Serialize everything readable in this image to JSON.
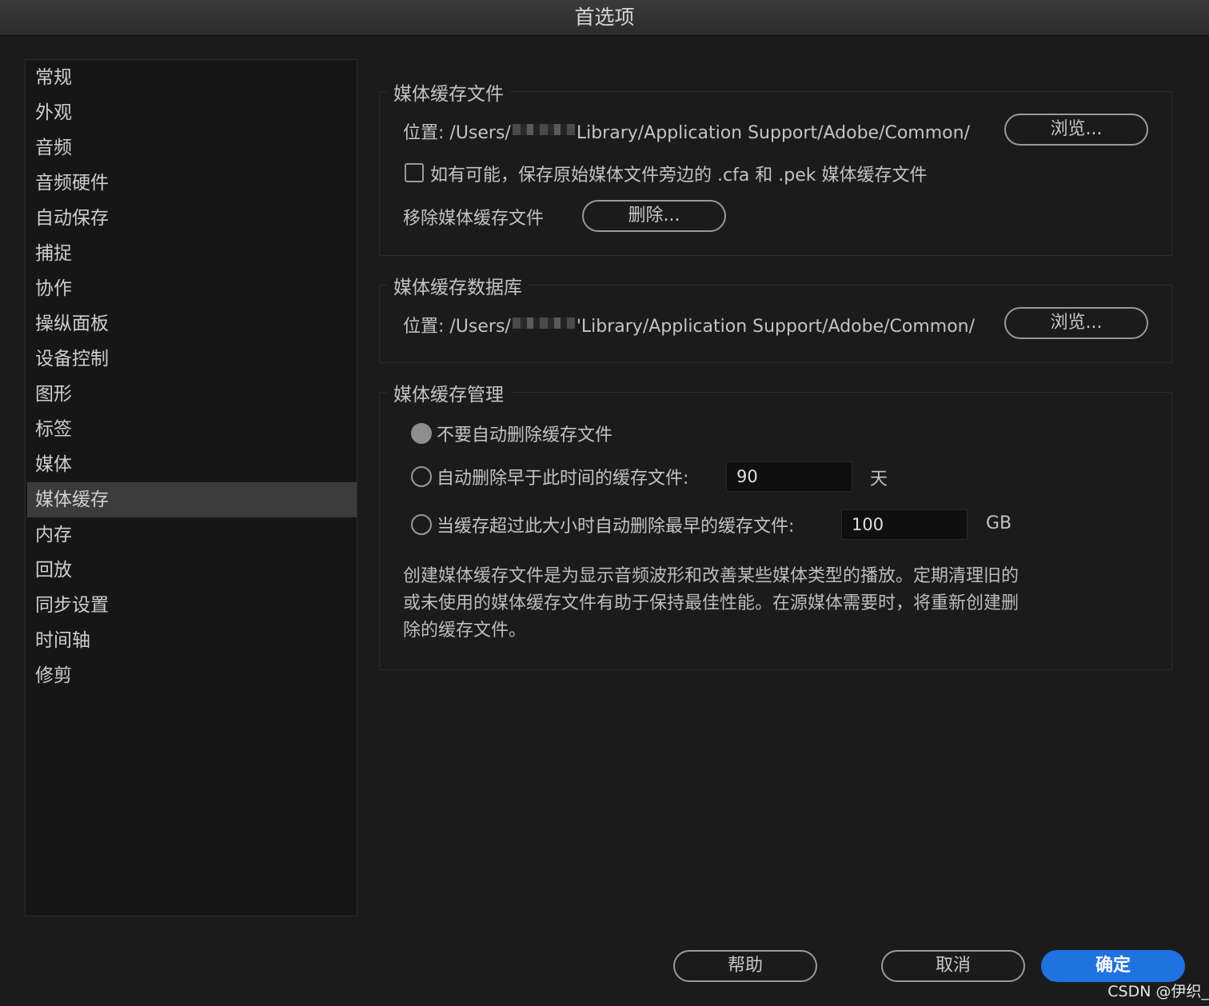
{
  "window": {
    "title": "首选项"
  },
  "sidebar": {
    "items": [
      {
        "label": "常规"
      },
      {
        "label": "外观"
      },
      {
        "label": "音频"
      },
      {
        "label": "音频硬件"
      },
      {
        "label": "自动保存"
      },
      {
        "label": "捕捉"
      },
      {
        "label": "协作"
      },
      {
        "label": "操纵面板"
      },
      {
        "label": "设备控制"
      },
      {
        "label": "图形"
      },
      {
        "label": "标签"
      },
      {
        "label": "媒体"
      },
      {
        "label": "媒体缓存",
        "selected": true
      },
      {
        "label": "内存"
      },
      {
        "label": "回放"
      },
      {
        "label": "同步设置"
      },
      {
        "label": "时间轴"
      },
      {
        "label": "修剪"
      }
    ]
  },
  "cache_files": {
    "title": "媒体缓存文件",
    "location_prefix": "位置: /Users/",
    "location_suffix": "Library/Application Support/Adobe/Common/",
    "browse_label": "浏览...",
    "save_beside_label": "如有可能，保存原始媒体文件旁边的 .cfa 和 .pek 媒体缓存文件",
    "save_beside_checked": false,
    "remove_label": "移除媒体缓存文件",
    "delete_label": "删除..."
  },
  "cache_db": {
    "title": "媒体缓存数据库",
    "location_prefix": "位置: /Users/",
    "location_suffix": "'Library/Application Support/Adobe/Common/",
    "browse_label": "浏览..."
  },
  "cache_mgmt": {
    "title": "媒体缓存管理",
    "option_never": "不要自动删除缓存文件",
    "option_older": "自动删除早于此时间的缓存文件:",
    "older_value": "90",
    "older_unit": "天",
    "option_size": "当缓存超过此大小时自动删除最早的缓存文件:",
    "size_value": "100",
    "size_unit": "GB",
    "selected_option": "never",
    "description_lines": [
      "创建媒体缓存文件是为显示音频波形和改善某些媒体类型的播放。定期清理旧的",
      "或未使用的媒体缓存文件有助于保持最佳性能。在源媒体需要时，将重新创建删",
      "除的缓存文件。"
    ]
  },
  "footer": {
    "help_label": "帮助",
    "cancel_label": "取消",
    "ok_label": "确定",
    "accent_color": "#1f72e0"
  },
  "watermark": "CSDN @伊织_"
}
